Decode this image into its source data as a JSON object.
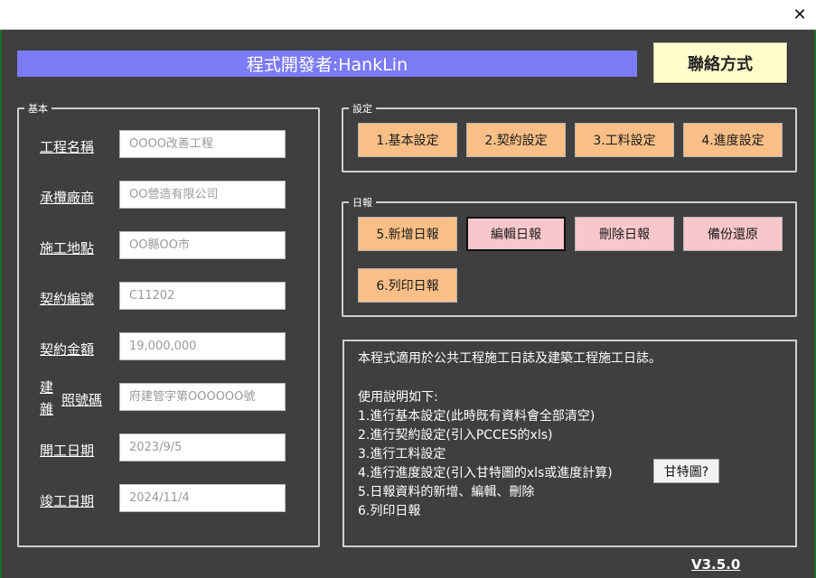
{
  "window": {
    "close_glyph": "✕"
  },
  "banner": {
    "text": "程式開發者:HankLin"
  },
  "contact_button": {
    "label": "聯絡方式"
  },
  "basic": {
    "legend": "基本",
    "fields": [
      {
        "label": "工程名稱",
        "value": "OOOO改善工程"
      },
      {
        "label": "承攬廠商",
        "value": "OO營造有限公司"
      },
      {
        "label": "施工地點",
        "value": "OO縣OO市"
      },
      {
        "label": "契約編號",
        "value": "C11202"
      },
      {
        "label": "契約金額",
        "value": "19,000,000"
      },
      {
        "label": "照號碼",
        "value": "府建管字第OOOOOO號",
        "vertical_label_top": "建",
        "vertical_label_bottom": "雜"
      },
      {
        "label": "開工日期",
        "value": "2023/9/5"
      },
      {
        "label": "竣工日期",
        "value": "2024/11/4"
      }
    ]
  },
  "settings": {
    "legend": "設定",
    "buttons": [
      "1.基本設定",
      "2.契約設定",
      "3.工料設定",
      "4.進度設定"
    ]
  },
  "daily": {
    "legend": "日報",
    "buttons": [
      "5.新增日報",
      "編輯日報",
      "刪除日報",
      "備份還原",
      "6.列印日報"
    ]
  },
  "info": {
    "lines": [
      "本程式適用於公共工程施工日誌及建築工程施工日誌。",
      "使用說明如下:",
      "1.進行基本設定(此時既有資料會全部清空)",
      "2.進行契約設定(引入PCCES的xls)",
      "3.進行工料設定",
      "4.進行進度設定(引入甘特圖的xls或進度計算)",
      "5.日報資料的新增、編輯、刪除",
      "6.列印日報"
    ],
    "gantt_button": "甘特圖?"
  },
  "version": "V3.5.0",
  "colors": {
    "background": "#3f3f3f",
    "banner": "#7b7bf5",
    "orange_button": "#f9bf86",
    "pink_button": "#f8c7cb",
    "contact_button": "#ffffcc"
  }
}
